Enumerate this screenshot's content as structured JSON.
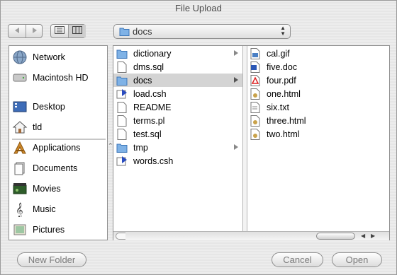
{
  "window": {
    "title": "File Upload"
  },
  "toolbar": {
    "back_icon": "back-arrow-icon",
    "forward_icon": "forward-arrow-icon",
    "list_view_icon": "list-view-icon",
    "column_view_icon": "column-view-icon",
    "location": "docs"
  },
  "sidebar": {
    "items": [
      {
        "label": "Network",
        "icon": "network-globe-icon"
      },
      {
        "label": "Macintosh HD",
        "icon": "hard-drive-icon"
      },
      {
        "label": "Desktop",
        "icon": "desktop-icon"
      },
      {
        "label": "tld",
        "icon": "home-icon"
      },
      {
        "label": "Applications",
        "icon": "applications-icon"
      },
      {
        "label": "Documents",
        "icon": "documents-icon"
      },
      {
        "label": "Movies",
        "icon": "movies-icon"
      },
      {
        "label": "Music",
        "icon": "music-icon"
      },
      {
        "label": "Pictures",
        "icon": "pictures-icon"
      }
    ]
  },
  "browser": {
    "column1": [
      {
        "label": "dictionary",
        "icon": "folder-icon",
        "has_children": true
      },
      {
        "label": "dms.sql",
        "icon": "text-file-icon"
      },
      {
        "label": "docs",
        "icon": "folder-icon",
        "has_children": true,
        "selected": true
      },
      {
        "label": "load.csh",
        "icon": "script-file-icon"
      },
      {
        "label": "README",
        "icon": "text-file-icon"
      },
      {
        "label": "terms.pl",
        "icon": "text-file-icon"
      },
      {
        "label": "test.sql",
        "icon": "text-file-icon"
      },
      {
        "label": "tmp",
        "icon": "folder-icon",
        "has_children": true
      },
      {
        "label": "words.csh",
        "icon": "script-file-icon"
      }
    ],
    "column2": [
      {
        "label": "cal.gif",
        "icon": "image-file-icon"
      },
      {
        "label": "five.doc",
        "icon": "word-doc-icon"
      },
      {
        "label": "four.pdf",
        "icon": "pdf-file-icon"
      },
      {
        "label": "one.html",
        "icon": "html-file-icon"
      },
      {
        "label": "six.txt",
        "icon": "text-file-icon"
      },
      {
        "label": "three.html",
        "icon": "html-file-icon"
      },
      {
        "label": "two.html",
        "icon": "html-file-icon"
      }
    ]
  },
  "buttons": {
    "new_folder": "New Folder",
    "cancel": "Cancel",
    "open": "Open"
  }
}
